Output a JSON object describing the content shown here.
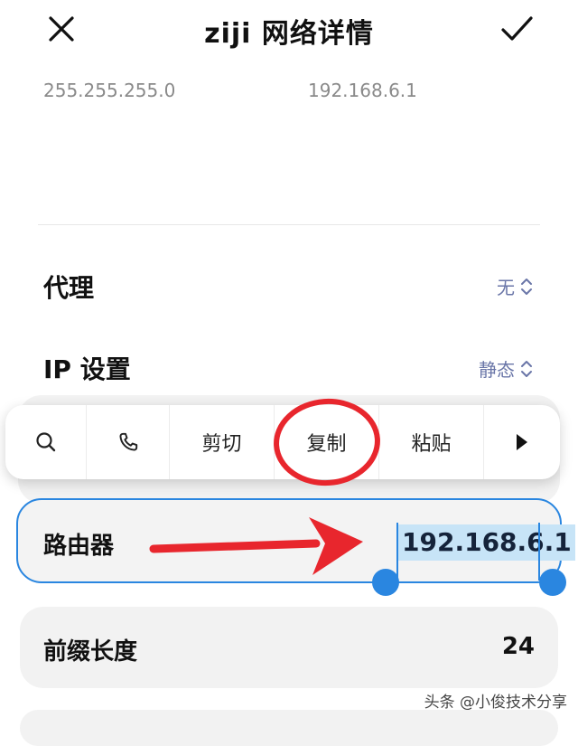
{
  "header": {
    "title": "ziji 网络详情",
    "close_icon": "close-icon",
    "confirm_icon": "check-icon"
  },
  "network": {
    "subnet_mask": "255.255.255.0",
    "gateway": "192.168.6.1"
  },
  "settings": {
    "proxy_label": "代理",
    "proxy_value": "无",
    "ip_label": "IP 设置",
    "ip_value": "静态"
  },
  "context_menu": {
    "search_icon": "search-icon",
    "phone_icon": "phone-icon",
    "cut": "剪切",
    "copy": "复制",
    "paste": "粘贴",
    "more_icon": "play-arrow-icon"
  },
  "router": {
    "label": "路由器",
    "value": "192.168.6.1"
  },
  "prefix": {
    "label": "前缀长度",
    "value": "24"
  },
  "watermark": "头条 @小俊技术分享",
  "colors": {
    "accent": "#2a86e0",
    "annotation": "#e8262d",
    "selection": "#c7e4f7"
  }
}
